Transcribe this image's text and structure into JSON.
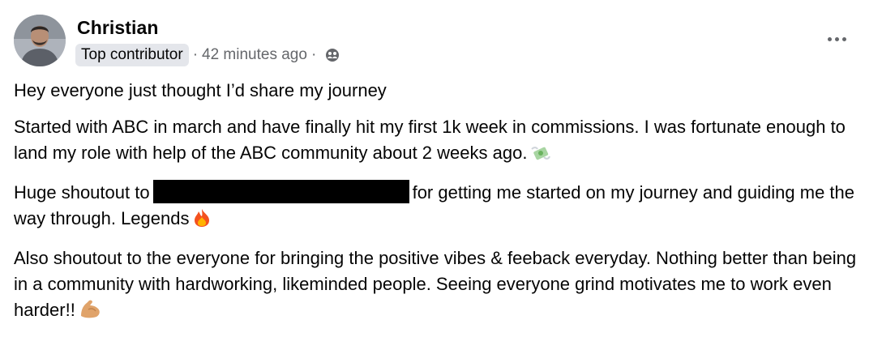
{
  "post": {
    "author_name": "Christian",
    "author_badge": "Top contributor",
    "separator": "·",
    "timestamp": "42 minutes ago",
    "privacy_icon": "group-audience-icon",
    "more_icon": "more-options-icon",
    "paragraphs": {
      "p1": "Hey everyone just thought I’d share my journey",
      "p2": "Started with ABC in march and have finally hit my first 1k week in commissions. I was fortunate enough to land my role with help of the ABC community about 2 weeks ago.",
      "p3_before": "Huge shoutout to",
      "p3_after": "for getting me started on my journey and guiding me the way through. Legends",
      "p4": "Also shoutout to the everyone for bringing the positive vibes & feeback everyday. Nothing better than being in a community with hardworking, likeminded people. Seeing everyone grind motivates me to work even harder!!"
    },
    "emojis": [
      "money-with-wings-icon",
      "fire-icon",
      "flexed-biceps-icon"
    ]
  }
}
